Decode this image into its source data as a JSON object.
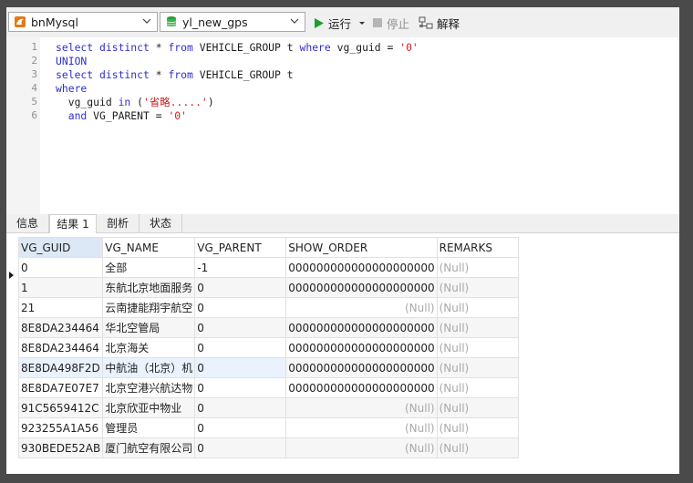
{
  "toolbar": {
    "connection": "bnMysql",
    "database": "yl_new_gps",
    "run_label": "运行",
    "stop_label": "停止",
    "explain_label": "解释"
  },
  "editor": {
    "line_numbers": [
      "1",
      "2",
      "3",
      "4",
      "5",
      "6"
    ],
    "lines": [
      [
        {
          "t": "select distinct",
          "c": "kw"
        },
        {
          "t": " * ",
          "c": "idt"
        },
        {
          "t": "from",
          "c": "kw"
        },
        {
          "t": " VEHICLE_GROUP t ",
          "c": "idt"
        },
        {
          "t": "where",
          "c": "kw"
        },
        {
          "t": " vg_guid = ",
          "c": "idt"
        },
        {
          "t": "'0'",
          "c": "str"
        }
      ],
      [
        {
          "t": "UNION",
          "c": "kw"
        }
      ],
      [
        {
          "t": "select distinct",
          "c": "kw"
        },
        {
          "t": " * ",
          "c": "idt"
        },
        {
          "t": "from",
          "c": "kw"
        },
        {
          "t": " VEHICLE_GROUP t",
          "c": "idt"
        }
      ],
      [
        {
          "t": "where",
          "c": "kw"
        }
      ],
      [
        {
          "t": "  vg_guid ",
          "c": "idt"
        },
        {
          "t": "in",
          "c": "kw"
        },
        {
          "t": " (",
          "c": "idt"
        },
        {
          "t": "'省略.....'",
          "c": "str"
        },
        {
          "t": ")",
          "c": "idt"
        }
      ],
      [
        {
          "t": "  ",
          "c": "idt"
        },
        {
          "t": "and",
          "c": "kw"
        },
        {
          "t": " VG_PARENT = ",
          "c": "idt"
        },
        {
          "t": "'0'",
          "c": "str"
        }
      ]
    ]
  },
  "tabs": [
    "信息",
    "结果 1",
    "剖析",
    "状态"
  ],
  "grid": {
    "columns": [
      "VG_GUID",
      "VG_NAME",
      "VG_PARENT",
      "SHOW_ORDER",
      "REMARKS"
    ],
    "null_text": "(Null)",
    "rows": [
      [
        "0",
        "全部",
        "-1",
        "000000000000000000000",
        null
      ],
      [
        "1",
        "东航北京地面服务",
        "0",
        "000000000000000000000",
        null
      ],
      [
        "21",
        "云南捷能翔宇航空",
        "0",
        null,
        null
      ],
      [
        "8E8DA234464",
        "华北空管局",
        "0",
        "000000000000000000000",
        null
      ],
      [
        "8E8DA234464",
        "北京海关",
        "0",
        "000000000000000000000",
        null
      ],
      [
        "8E8DA498F2D",
        "中航油（北京）机",
        "0",
        "000000000000000000000",
        null
      ],
      [
        "8E8DA7E07E7",
        "北京空港兴航达物",
        "0",
        "000000000000000000000",
        null
      ],
      [
        "91C5659412C",
        "北京欣亚中物业",
        "0",
        null,
        null
      ],
      [
        "923255A1A56",
        "管理员",
        "0",
        null,
        null
      ],
      [
        "930BEDE52AB",
        "厦门航空有限公司",
        "0",
        null,
        null
      ]
    ]
  },
  "colors": {
    "keyword": "#2f2fcf",
    "string": "#cc1f1f",
    "null": "#a9a9a9",
    "run_green": "#1e9e2c"
  }
}
